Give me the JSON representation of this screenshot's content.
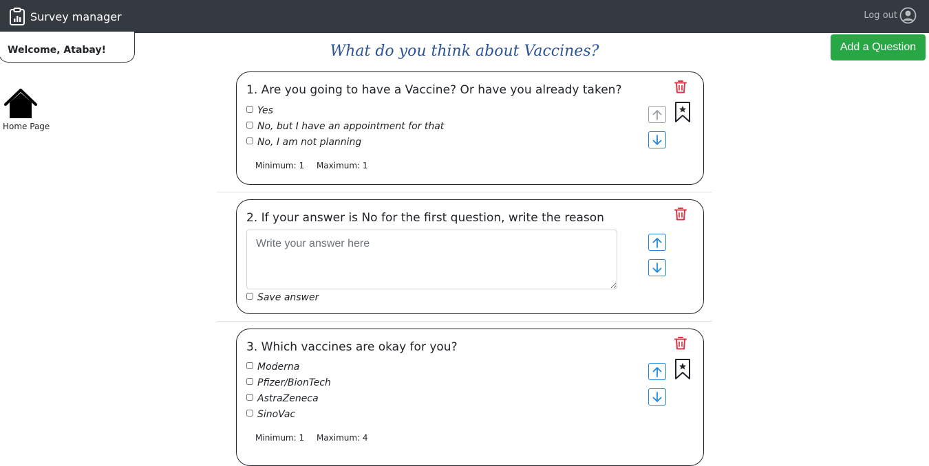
{
  "navbar": {
    "brand": "Survey manager",
    "logout_label": "Log out"
  },
  "welcome": "Welcome, Atabay!",
  "sidebar": {
    "home_label": "Home Page"
  },
  "survey": {
    "title": "What do you think about Vaccines?"
  },
  "add_question_label": "Add a Question",
  "questions": [
    {
      "title": "1. Are you going to have a Vaccine? Or have you already taken?",
      "options": [
        "Yes",
        "No, but I have an appointment for that",
        "No, I am not planning"
      ],
      "min_label": "Minimum: 1",
      "max_label": "Maximum: 1"
    },
    {
      "title": "2. If your answer is No for the first question, write the reason",
      "answer_placeholder": "Write your answer here",
      "save_label": "Save answer"
    },
    {
      "title": "3. Which vaccines are okay for you?",
      "options": [
        "Moderna",
        "Pfizer/BionTech",
        "AstraZeneca",
        "SinoVac"
      ],
      "min_label": "Minimum: 1",
      "max_label": "Maximum: 4"
    }
  ],
  "colors": {
    "navbar": "#343a40",
    "title": "#2d5594",
    "add_button": "#28a745",
    "delete": "#dc3545",
    "arrow": "#1e88e5"
  }
}
